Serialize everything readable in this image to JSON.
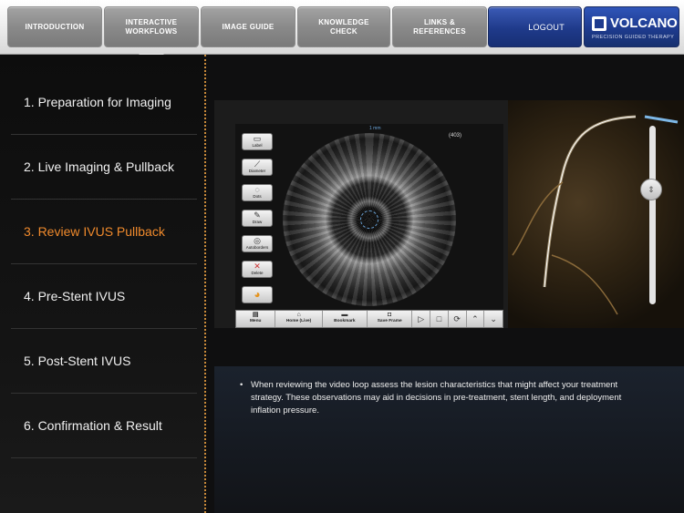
{
  "nav": {
    "tabs": [
      {
        "label": "INTRODUCTION"
      },
      {
        "label": "INTERACTIVE WORKFLOWS"
      },
      {
        "label": "IMAGE GUIDE"
      },
      {
        "label": "KNOWLEDGE CHECK"
      },
      {
        "label": "LINKS & REFERENCES"
      }
    ],
    "logout_label": "LOGOUT",
    "brand": {
      "name": "VOLCANO",
      "tagline": "PRECISION GUIDED THERAPY"
    }
  },
  "sidebar": {
    "items": [
      {
        "label": "1. Preparation for Imaging"
      },
      {
        "label": "2. Live Imaging & Pullback"
      },
      {
        "label": "3. Review IVUS Pullback"
      },
      {
        "label": "4. Pre-Stent IVUS"
      },
      {
        "label": "5. Post-Stent IVUS"
      },
      {
        "label": "6. Confirmation & Result"
      }
    ],
    "active_index": 2
  },
  "viewer": {
    "scale_label": "1 mm",
    "frame_number": "(403)",
    "tools": [
      "Label",
      "Diameter",
      "Dots",
      "Draw",
      "Autoborders",
      "Delete",
      ""
    ],
    "bottom_buttons": [
      "Menu",
      "Home (Live)",
      "Bookmark",
      "Save Frame"
    ]
  },
  "notes": {
    "bullet": "When reviewing the video loop assess the lesion characteristics that might affect your treatment strategy. These observations may aid in decisions in pre-treatment, stent length, and deployment inflation pressure."
  },
  "colors": {
    "active": "#f08a2c",
    "brand_blue": "#1e3b8e",
    "divider": "#c98a3a"
  }
}
